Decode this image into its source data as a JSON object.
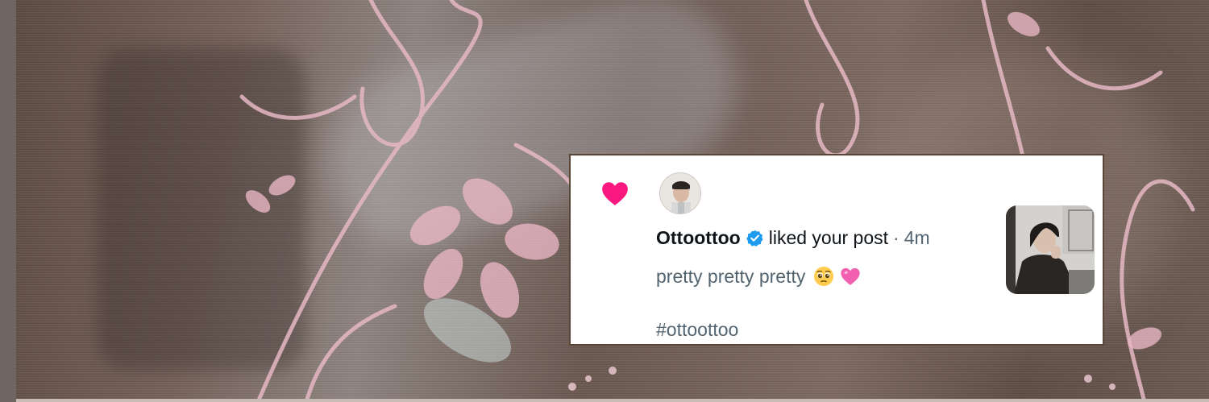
{
  "notification": {
    "username": "Ottoottoo",
    "action": "liked your post",
    "separator": "·",
    "time": "4m",
    "post_text": "pretty pretty pretty",
    "hashtag": "#ottoottoo"
  },
  "icons": {
    "like": "heart-icon",
    "verified": "verified-badge-icon",
    "emoji_1": "pleading-face-icon",
    "emoji_2": "pink-heart-icon"
  },
  "colors": {
    "like_heart": "#f91880",
    "verified": "#1d9bf0",
    "username": "#0f1419",
    "secondary_text": "#536471",
    "card_border": "#5a4638"
  }
}
